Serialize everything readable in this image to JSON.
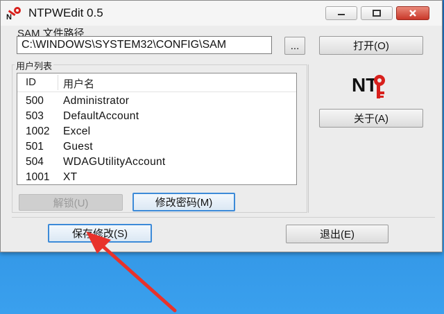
{
  "window": {
    "title": "NTPWEdit 0.5"
  },
  "sam": {
    "group_label": "SAM 文件路径",
    "path_value": "C:\\WINDOWS\\SYSTEM32\\CONFIG\\SAM",
    "browse_label": "...",
    "open_label": "打开(O)"
  },
  "users": {
    "group_label": "用户列表",
    "columns": [
      "ID",
      "用户名"
    ],
    "rows": [
      {
        "id": "500",
        "name": "Administrator"
      },
      {
        "id": "503",
        "name": "DefaultAccount"
      },
      {
        "id": "1002",
        "name": "Excel"
      },
      {
        "id": "501",
        "name": "Guest"
      },
      {
        "id": "504",
        "name": "WDAGUtilityAccount"
      },
      {
        "id": "1001",
        "name": "XT"
      }
    ],
    "unlock_label": "解锁(U)",
    "change_password_label": "修改密码(M)"
  },
  "about_label": "关于(A)",
  "logo": {
    "text": "NT"
  },
  "footer": {
    "save_label": "保存修改(S)",
    "exit_label": "退出(E)"
  },
  "colors": {
    "desktop": "#1f7fd0",
    "window_bg": "#ececec",
    "close_button": "#c9382a",
    "focus_border": "#3c8ad8",
    "annotation_arrow": "#e8322b",
    "logo_red": "#d8201c"
  }
}
